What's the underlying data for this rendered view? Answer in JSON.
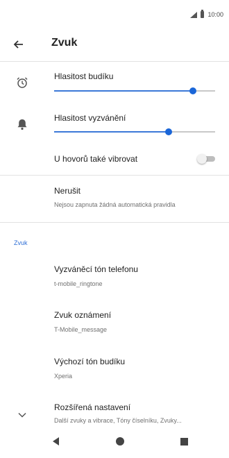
{
  "status_bar": {
    "time": "10:00",
    "icons": [
      "signal-icon",
      "battery-icon"
    ]
  },
  "app_bar": {
    "title": "Zvuk",
    "back_icon": "arrow-back-icon"
  },
  "volume": {
    "alarm": {
      "label": "Hlasitost budíku",
      "icon": "alarm-icon",
      "level_fraction": 0.86
    },
    "ringtone": {
      "label": "Hlasitost vyzvánění",
      "icon": "bell-icon",
      "level_fraction": 0.71
    }
  },
  "vibrate": {
    "label": "U hovorů také vibrovat",
    "enabled": false
  },
  "dnd": {
    "label": "Nerušit",
    "summary": "Nejsou zapnuta žádná automatická pravidla"
  },
  "section_title": "Zvuk",
  "items": [
    {
      "label": "Vyzváněcí tón telefonu",
      "summary": "t-mobile_ringtone"
    },
    {
      "label": "Zvuk oznámení",
      "summary": "T-Mobile_message"
    },
    {
      "label": "Výchozí tón budíku",
      "summary": "Xperia"
    }
  ],
  "advanced": {
    "label": "Rozšířená nastavení",
    "summary": "Další zvuky a vibrace, Tóny číselníku, Zvuky...",
    "icon": "chevron-down-icon"
  },
  "nav": {
    "back": "nav-back-icon",
    "home": "nav-home-icon",
    "recents": "nav-recents-icon"
  },
  "colors": {
    "accent": "#1a66d8",
    "section": "#2f6fd6",
    "divider": "#e2e2e2"
  }
}
